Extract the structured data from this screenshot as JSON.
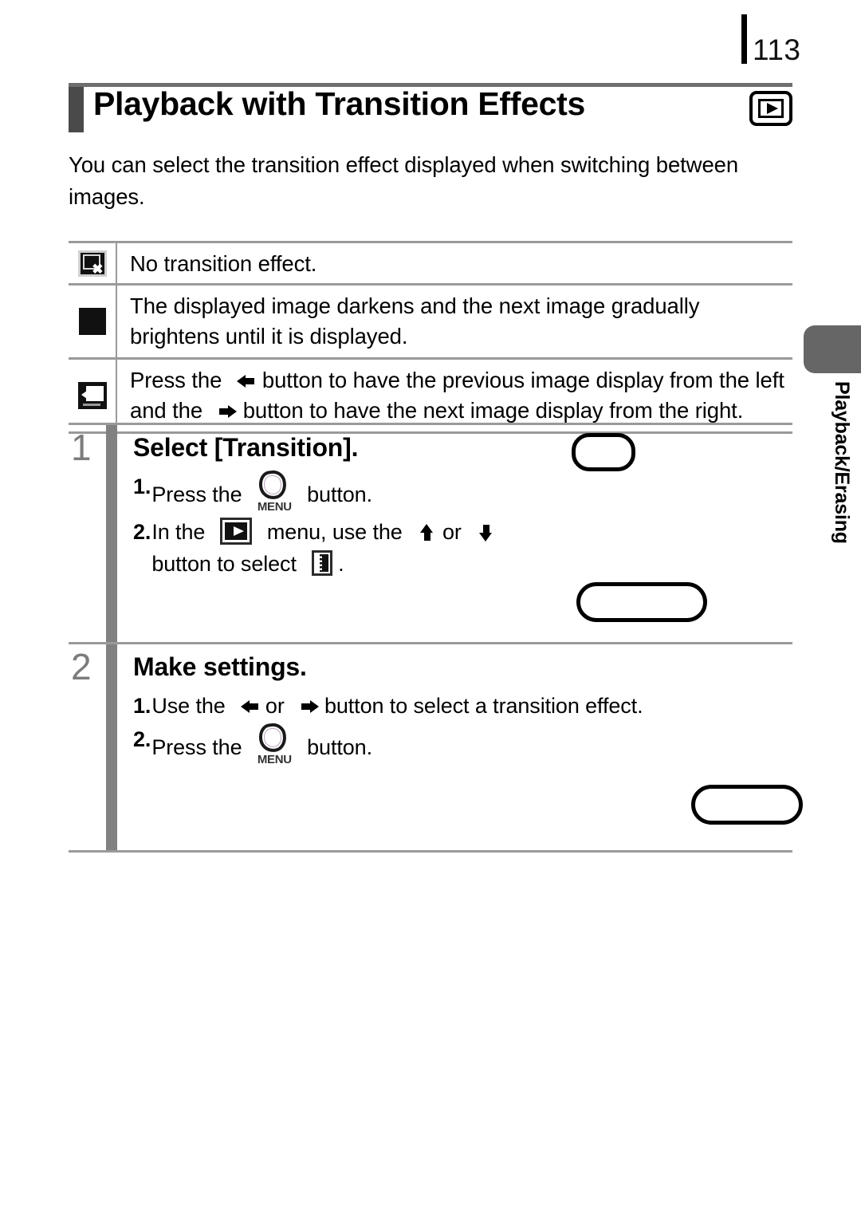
{
  "page": {
    "number": "113"
  },
  "heading": {
    "title": "Playback with Transition Effects",
    "icon": "playback-mode-icon"
  },
  "intro": {
    "text": "You can select the transition effect displayed when switching between images."
  },
  "effects_table": {
    "rows": [
      {
        "icon": "no-transition-icon",
        "text": "No transition effect."
      },
      {
        "icon": "fade-transition-icon",
        "text": "The displayed image darkens and the next image gradually brightens until it is displayed."
      },
      {
        "icon": "scroll-transition-icon",
        "text_part_1": "Press the",
        "arrow_1": "arrow-left-icon",
        "text_part_2": "button to have the previous image display from the left and the",
        "arrow_2": "arrow-right-icon",
        "text_part_3": "button to have the next image display from the right."
      }
    ]
  },
  "steps": [
    {
      "number": "1",
      "title": "Select [Transition].",
      "substeps": [
        {
          "number": "1.",
          "text_part_1": "Press the",
          "icon_1": "menu-button-icon",
          "icon_1_caption": "MENU",
          "text_part_2": "button."
        },
        {
          "number": "2.",
          "text_part_1": "In the",
          "icon_1": "playback-mode-icon",
          "text_part_2": "menu, use the",
          "arrow_1": "arrow-up-icon",
          "text_part_3": "or",
          "arrow_2": "arrow-down-icon",
          "text_part_4": "button to select",
          "icon_2": "transition-effect-icon",
          "text_part_5": "."
        }
      ]
    },
    {
      "number": "2",
      "title": "Make settings.",
      "substeps": [
        {
          "number": "1.",
          "text_part_1": "Use the",
          "arrow_1": "arrow-left-icon",
          "text_part_2": "or",
          "arrow_2": "arrow-right-icon",
          "text_part_3": "button to select a transition effect."
        },
        {
          "number": "2.",
          "text_part_1": "Press the",
          "icon_1": "menu-button-icon",
          "icon_1_caption": "MENU",
          "text_part_2": "button."
        }
      ]
    }
  ],
  "side_tab": {
    "label": "Playback/Erasing",
    "color": "#666666"
  },
  "colors": {
    "rule_gray": "#9a9a9a",
    "heading_accent": "#4a4a4a",
    "step_bar": "#818181",
    "step_number": "#7c7c7c"
  }
}
